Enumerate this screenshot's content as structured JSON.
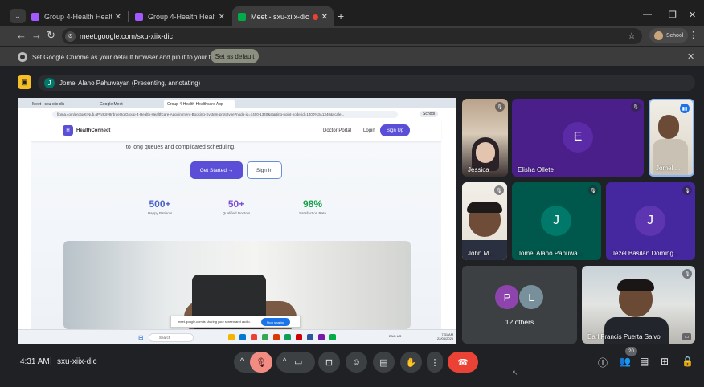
{
  "browser": {
    "tabs": [
      {
        "label": "Group 4-Health Healthcare App",
        "favicon_color": "#a259ff"
      },
      {
        "label": "Group 4-Health Healthcare App",
        "favicon_color": "#a259ff"
      },
      {
        "label": "Meet - sxu-xiix-dic",
        "favicon_color": "#00ac47"
      }
    ],
    "tab_close": "✕",
    "new_tab": "+",
    "url": "meet.google.com/sxu-xiix-dic",
    "profile_label": "School",
    "infobar": {
      "message": "Set Google Chrome as your default browser and pin it to your taskbar",
      "button": "Set as default"
    }
  },
  "meet": {
    "presenter_initial": "J",
    "presenter_banner": "Jomel Alano Pahuwayan (Presenting, annotating)",
    "time": "4:31 AM",
    "divider": "|",
    "meeting_code": "sxu-xiix-dic",
    "participant_count": "20",
    "participants": [
      {
        "name": "Jessica",
        "initial": ""
      },
      {
        "name": "Elisha Ollete",
        "initial": "E",
        "color": "#5b2aa6"
      },
      {
        "name": "Jomel ...",
        "initial": ""
      },
      {
        "name": "John M...",
        "initial": ""
      },
      {
        "name": "Jomel Alano Pahuwa...",
        "initial": "J",
        "color": "#00796b"
      },
      {
        "name": "Jezel Basilan Doming...",
        "initial": "J",
        "color": "#5e35b1"
      },
      {
        "name": "12 others",
        "initial": "",
        "avatars": [
          "P",
          "L"
        ]
      },
      {
        "name": "Earl Francis Puerta Salvo",
        "initial": ""
      }
    ]
  },
  "shared": {
    "tabs": [
      "Meet - sxu-xiix-dic",
      "Google Meet",
      "Group 4-Health Healthcare App"
    ],
    "url": "figma.com/proto/KrNub.gPnrK6v8rdrgeOg/Group-4-Health-Healthcare-Appointment-Booking-System-prototype?node-id=1400-1340&starting-point-node-id=1400%3A1340&scale...",
    "school": "School",
    "logo_letter": "H",
    "brand": "HealthConnect",
    "doctor_portal": "Doctor Portal",
    "login": "Login",
    "signup": "Sign Up",
    "subtitle": "to long queues and complicated scheduling.",
    "get_started": "Get Started →",
    "sign_in": "Sign In",
    "stats": [
      {
        "value": "500+",
        "label": "Happy Patients",
        "color": "#4a63c9"
      },
      {
        "value": "50+",
        "label": "Qualified Doctors",
        "color": "#7b4fd6"
      },
      {
        "value": "98%",
        "label": "Satisfaction Rate",
        "color": "#14a34a"
      }
    ],
    "toast": "meet.google.com is sharing your screen and audio.",
    "toast_button": "Stop sharing",
    "taskbar_search": "Search",
    "taskbar_clock": "7:31 AM\n22/04/2025",
    "taskbar_lang": "ENG US"
  }
}
